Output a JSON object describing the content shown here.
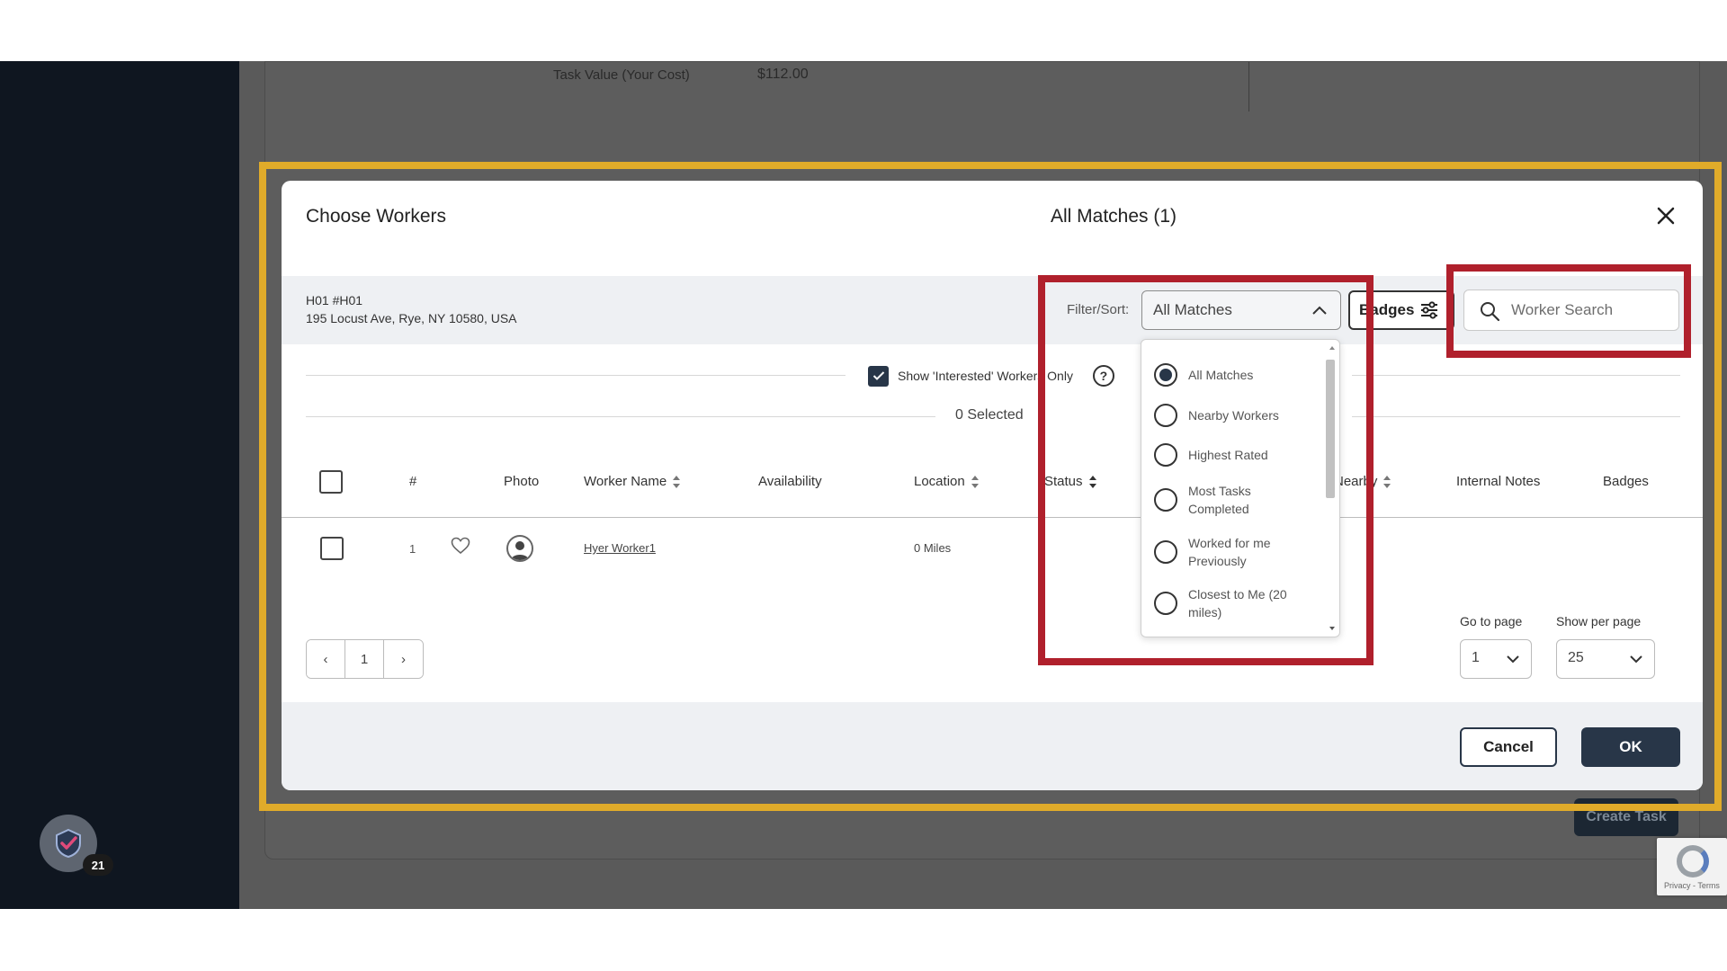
{
  "background": {
    "task_value_label": "Task Value (Your Cost)",
    "task_value": "$112.00",
    "create_task_label": "Create Task",
    "recaptcha_text": "Privacy - Terms",
    "chat_badge_count": "21"
  },
  "modal": {
    "title": "Choose Workers",
    "center_title": "All Matches (1)",
    "address_line1": "H01 #H01",
    "address_line2": "195 Locust Ave, Rye, NY 10580, USA",
    "filter_label": "Filter/Sort:",
    "filter_value": "All Matches",
    "badges_label": "Badges",
    "search_placeholder": "Worker Search",
    "interested_label": "Show 'Interested' Workers Only",
    "interested_checked": true,
    "help_glyph": "?",
    "selected_count": "0 Selected",
    "columns": {
      "num": "#",
      "photo": "Photo",
      "worker_name": "Worker Name",
      "availability": "Availability",
      "location": "Location",
      "status": "Status",
      "nearby": "Nearby",
      "internal_notes": "Internal Notes",
      "badges": "Badges"
    },
    "rows": [
      {
        "num": "1",
        "name": "Hyer Worker1",
        "location": "0 Miles"
      }
    ],
    "pagination": {
      "prev": "‹",
      "page": "1",
      "next": "›"
    },
    "goto_label": "Go to page",
    "goto_value": "1",
    "perpage_label": "Show per page",
    "perpage_value": "25",
    "cancel_label": "Cancel",
    "ok_label": "OK"
  },
  "filter_dropdown": {
    "options": [
      {
        "label": "All Matches",
        "selected": true
      },
      {
        "label": "Nearby Workers",
        "selected": false
      },
      {
        "label": "Highest Rated",
        "selected": false
      },
      {
        "label": "Most Tasks Completed",
        "selected": false
      },
      {
        "label": "Worked for me Previously",
        "selected": false
      },
      {
        "label": "Closest to Me (20 miles)",
        "selected": false
      }
    ]
  },
  "colors": {
    "accent_dark": "#283648",
    "highlight_yellow": "#e0ab2a",
    "highlight_red": "#b0202c"
  }
}
